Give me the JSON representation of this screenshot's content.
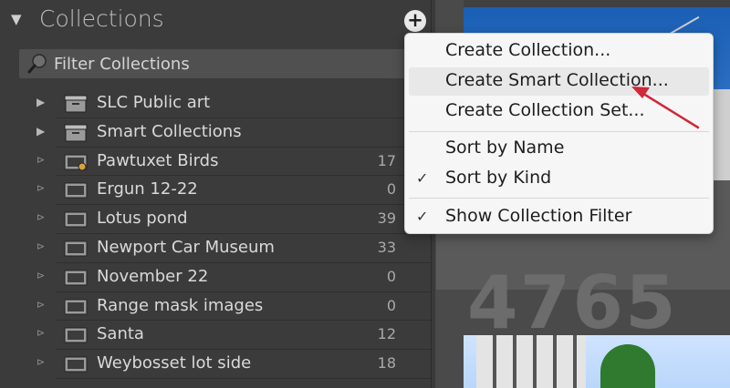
{
  "collections_panel": {
    "title": "Collections",
    "expand_glyph": "▼",
    "add_glyph": "+",
    "filter_placeholder": "Filter Collections",
    "items": [
      {
        "label": "SLC Public art",
        "count": "",
        "kind": "set",
        "expander": "▶"
      },
      {
        "label": "Smart Collections",
        "count": "",
        "kind": "set",
        "expander": "▶"
      },
      {
        "label": "Pawtuxet Birds",
        "count": "17",
        "kind": "smart",
        "expander": "⊳"
      },
      {
        "label": "Ergun 12-22",
        "count": "0",
        "kind": "collection",
        "expander": "⊳"
      },
      {
        "label": "Lotus pond",
        "count": "39",
        "kind": "collection",
        "expander": "⊳"
      },
      {
        "label": "Newport Car Museum",
        "count": "33",
        "kind": "collection",
        "expander": "⊳"
      },
      {
        "label": "November 22",
        "count": "0",
        "kind": "collection",
        "expander": "⊳"
      },
      {
        "label": "Range mask images",
        "count": "0",
        "kind": "collection",
        "expander": "⊳"
      },
      {
        "label": "Santa",
        "count": "12",
        "kind": "collection",
        "expander": "⊳"
      },
      {
        "label": "Weybosset lot side",
        "count": "18",
        "kind": "collection",
        "expander": "⊳"
      }
    ]
  },
  "menu": {
    "items": [
      {
        "label": "Create Collection...",
        "checked": false
      },
      {
        "label": "Create Smart Collection...",
        "checked": false,
        "highlighted": true
      },
      {
        "label": "Create Collection Set...",
        "checked": false
      },
      {
        "label": "Sort by Name",
        "checked": false
      },
      {
        "label": "Sort by Kind",
        "checked": true
      },
      {
        "label": "Show Collection Filter",
        "checked": true
      }
    ],
    "check_glyph": "✓"
  },
  "background": {
    "big_number": "4765"
  },
  "colors": {
    "panel_bg": "#3b3b3b",
    "menu_bg": "#f6f6f6",
    "annotation_arrow": "#d0283a"
  }
}
